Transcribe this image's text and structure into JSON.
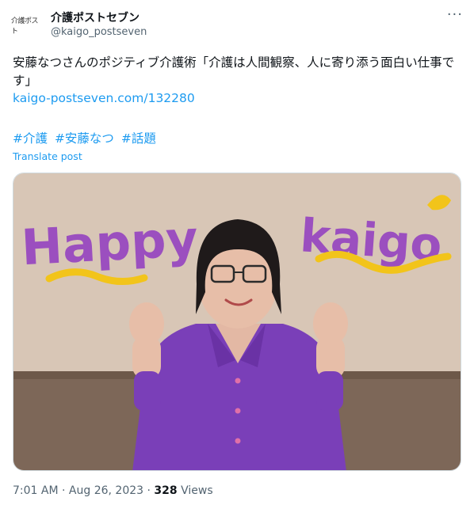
{
  "account": {
    "avatar_text": "介護ポスト",
    "name": "介護ポストセブン",
    "handle": "@kaigo_postseven"
  },
  "tweet": {
    "text": "安藤なつさんのポジティブ介護術「介護は人間観察、人に寄り添う面白い仕事です」",
    "link": "kaigo-postseven.com/132280",
    "hashtags": [
      "#介護",
      "#安藤なつ",
      "#話題"
    ],
    "translate_label": "Translate post"
  },
  "image": {
    "left_word": "Happy",
    "right_word": "kaigo",
    "colors": {
      "lettering": "#9b4fbf",
      "squiggle": "#f2c41a",
      "shirt": "#7a3fb8",
      "wall": "#d8c6b6"
    }
  },
  "meta": {
    "time": "7:01 AM",
    "separator": "·",
    "date": "Aug 26, 2023",
    "views_count": "328",
    "views_label": "Views"
  },
  "icons": {
    "more": "more-dots-icon"
  }
}
